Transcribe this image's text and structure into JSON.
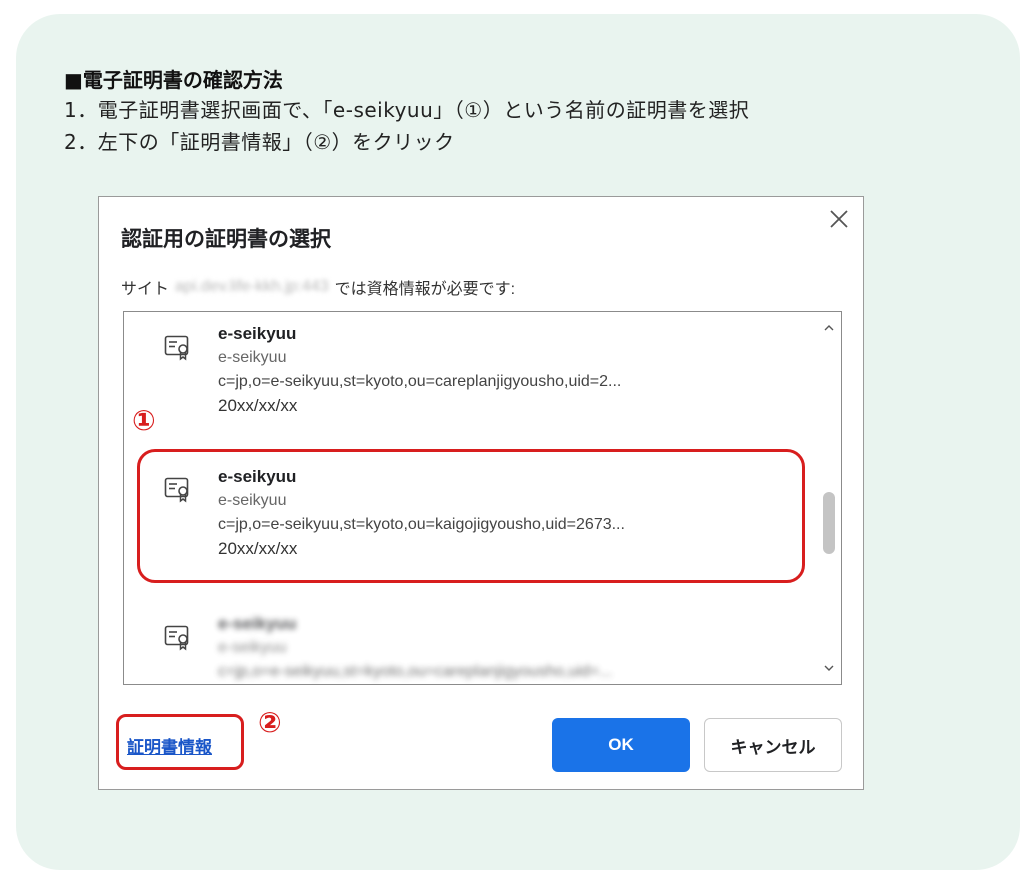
{
  "instructions": {
    "title": "■電子証明書の確認方法",
    "step1": "1．電子証明書選択画面で、「e-seikyuu」（①）という名前の証明書を選択",
    "step2": "2．左下の「証明書情報」（②）をクリック"
  },
  "dialog": {
    "title": "認証用の証明書の選択",
    "subtitle_prefix": "サイト",
    "site_blurred": "api.dev.life-kkh.jp:443",
    "subtitle_suffix": "では資格情報が必要です:",
    "certificates": [
      {
        "name": "e-seikyuu",
        "issuer": "e-seikyuu",
        "dn": "c=jp,o=e-seikyuu,st=kyoto,ou=careplanjigyousho,uid=2...",
        "date": "20xx/xx/xx"
      },
      {
        "name": "e-seikyuu",
        "issuer": "e-seikyuu",
        "dn": "c=jp,o=e-seikyuu,st=kyoto,ou=kaigojigyousho,uid=2673...",
        "date": "20xx/xx/xx"
      },
      {
        "name": "e-seikyuu",
        "issuer": "e-seikyuu",
        "dn": "c=jp,o=e-seikyuu,st=kyoto,ou=careplanjigyousho,uid=..."
      }
    ],
    "cert_info_link": "証明書情報",
    "ok_label": "OK",
    "cancel_label": "キャンセル",
    "icons": {
      "close": "close-icon",
      "certificate": "certificate-icon",
      "scroll_up": "chevron-up-icon",
      "scroll_down": "chevron-down-icon"
    }
  },
  "annotations": {
    "marker1": "①",
    "marker2": "②"
  },
  "colors": {
    "panel_bg": "#e9f4ef",
    "accent_red": "#d81e1e",
    "ok_button": "#1a73e8",
    "link": "#1a56c8"
  }
}
